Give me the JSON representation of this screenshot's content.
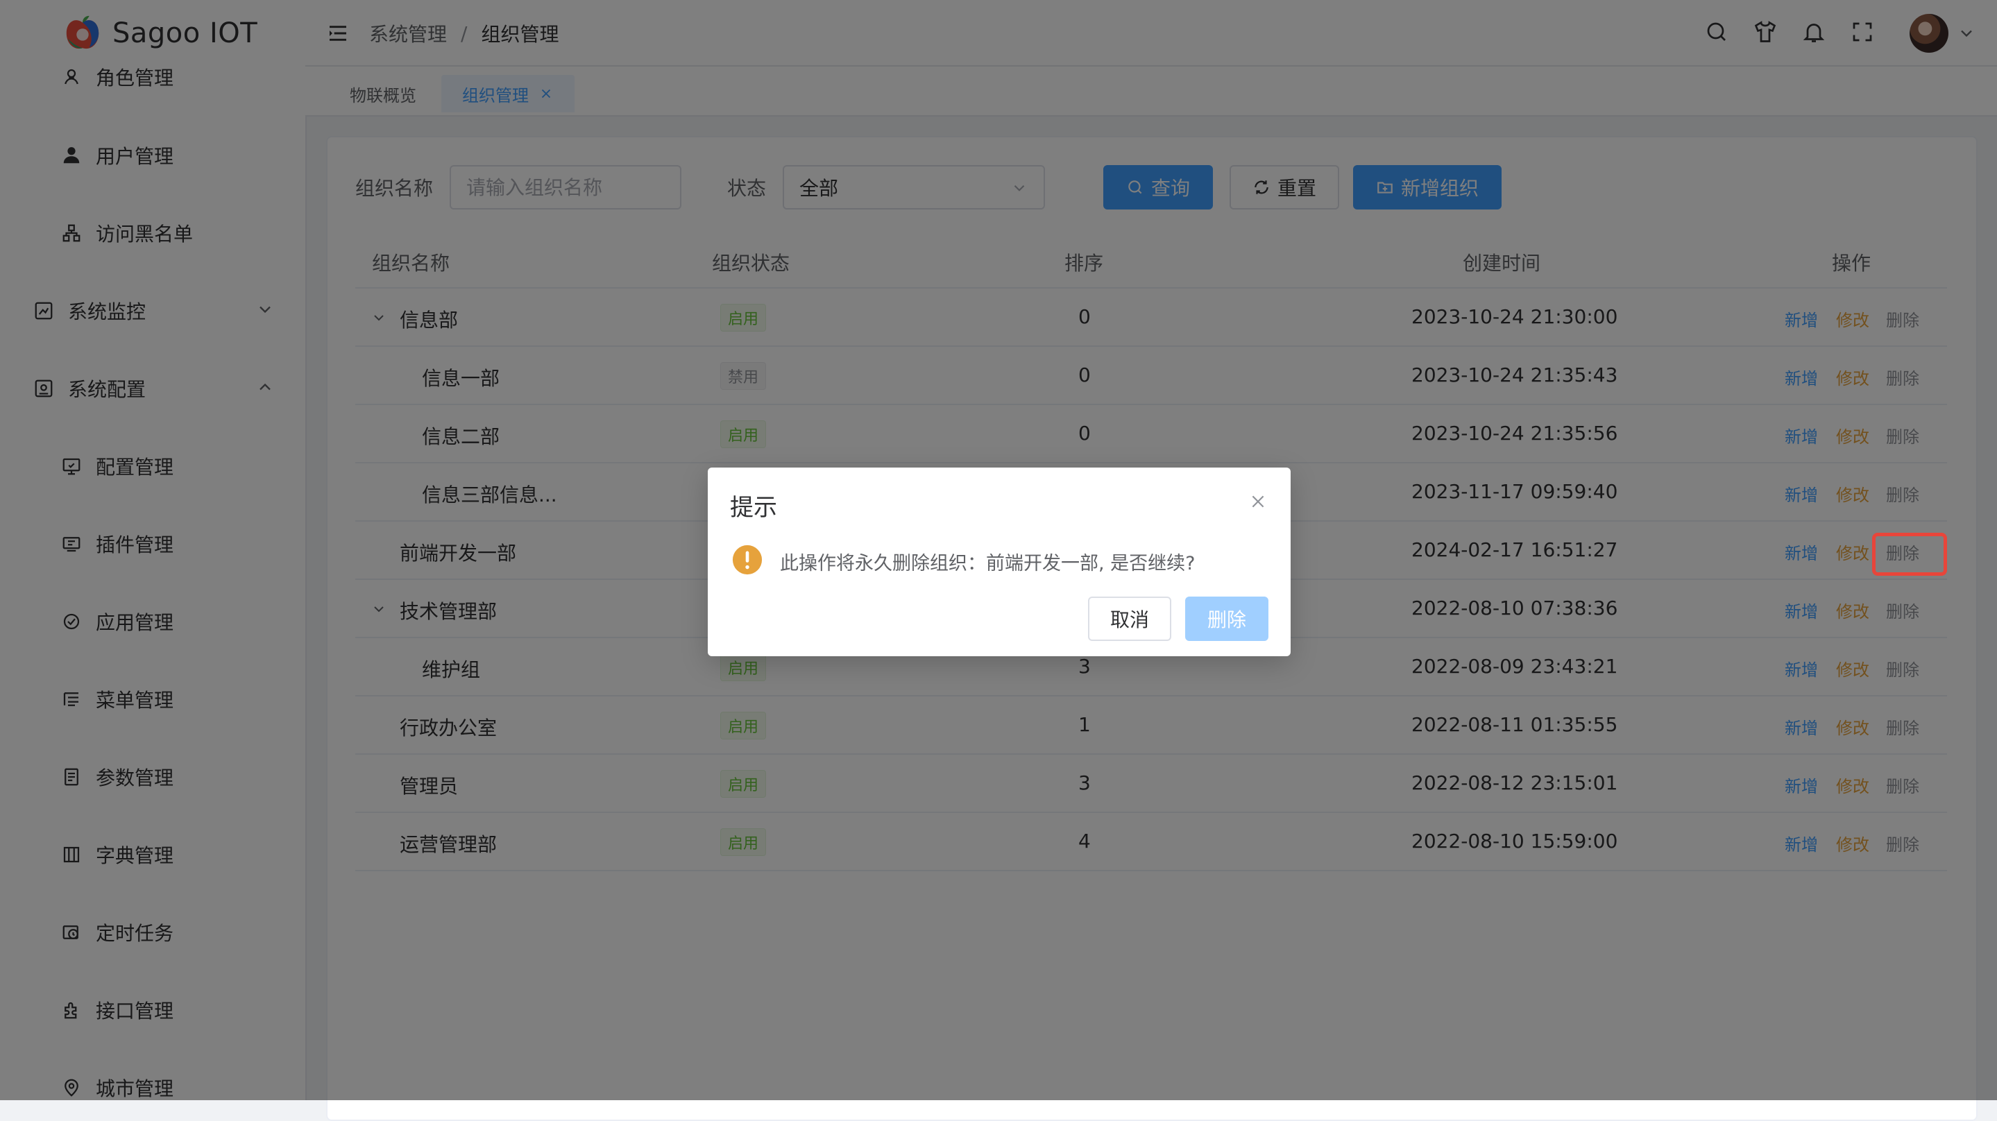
{
  "app": {
    "title": "Sagoo IOT"
  },
  "sidebar": {
    "items": [
      {
        "label": "角色管理",
        "icon": "role-icon"
      },
      {
        "label": "用户管理",
        "icon": "user-icon"
      },
      {
        "label": "访问黑名单",
        "icon": "blacklist-icon"
      },
      {
        "label": "系统监控",
        "icon": "monitor-icon",
        "expanded": false
      },
      {
        "label": "系统配置",
        "icon": "config-icon",
        "expanded": true
      },
      {
        "label": "配置管理",
        "icon": "settings-screen-icon"
      },
      {
        "label": "插件管理",
        "icon": "plugin-icon"
      },
      {
        "label": "应用管理",
        "icon": "app-icon"
      },
      {
        "label": "菜单管理",
        "icon": "menu-icon"
      },
      {
        "label": "参数管理",
        "icon": "param-icon"
      },
      {
        "label": "字典管理",
        "icon": "dictionary-icon"
      },
      {
        "label": "定时任务",
        "icon": "timer-icon"
      },
      {
        "label": "接口管理",
        "icon": "api-icon"
      },
      {
        "label": "城市管理",
        "icon": "location-icon"
      }
    ]
  },
  "header": {
    "breadcrumb": [
      "系统管理",
      "/",
      "组织管理"
    ]
  },
  "tabs": [
    {
      "label": "物联概览",
      "active": false
    },
    {
      "label": "组织管理",
      "active": true
    }
  ],
  "filters": {
    "name_label": "组织名称",
    "name_placeholder": "请输入组织名称",
    "status_label": "状态",
    "status_value": "全部",
    "query_button": "查询",
    "reset_button": "重置",
    "add_button": "新增组织"
  },
  "table": {
    "columns": [
      "组织名称",
      "组织状态",
      "排序",
      "创建时间",
      "操作"
    ],
    "actions": {
      "add": "新增",
      "edit": "修改",
      "delete": "删除"
    },
    "rows": [
      {
        "name": "信息部",
        "level": 0,
        "expandable": true,
        "status": "启用",
        "sort": "0",
        "created": "2023-10-24 21:30:00"
      },
      {
        "name": "信息一部",
        "level": 1,
        "expandable": false,
        "status": "禁用",
        "sort": "0",
        "created": "2023-10-24 21:35:43"
      },
      {
        "name": "信息二部",
        "level": 1,
        "expandable": false,
        "status": "启用",
        "sort": "0",
        "created": "2023-10-24 21:35:56"
      },
      {
        "name": "信息三部信息...",
        "level": 1,
        "expandable": false,
        "status": "",
        "sort": "",
        "created": "2023-11-17 09:59:40"
      },
      {
        "name": "前端开发一部",
        "level": 0,
        "expandable": false,
        "status": "",
        "sort": "",
        "created": "2024-02-17 16:51:27"
      },
      {
        "name": "技术管理部",
        "level": 0,
        "expandable": true,
        "status": "",
        "sort": "",
        "created": "2022-08-10 07:38:36"
      },
      {
        "name": "维护组",
        "level": 1,
        "expandable": false,
        "status": "启用",
        "sort": "3",
        "created": "2022-08-09 23:43:21"
      },
      {
        "name": "行政办公室",
        "level": 0,
        "expandable": false,
        "status": "启用",
        "sort": "1",
        "created": "2022-08-11 01:35:55"
      },
      {
        "name": "管理员",
        "level": 0,
        "expandable": false,
        "status": "启用",
        "sort": "3",
        "created": "2022-08-12 23:15:01"
      },
      {
        "name": "运营管理部",
        "level": 0,
        "expandable": false,
        "status": "启用",
        "sort": "4",
        "created": "2022-08-10 15:59:00"
      }
    ]
  },
  "dialog": {
    "title": "提示",
    "message": "此操作将永久删除组织：前端开发一部, 是否继续?",
    "cancel": "取消",
    "confirm": "删除"
  },
  "colors": {
    "primary": "#409eff",
    "warning": "#e6a23c",
    "success": "#67c23a",
    "highlight": "#e8453a"
  }
}
